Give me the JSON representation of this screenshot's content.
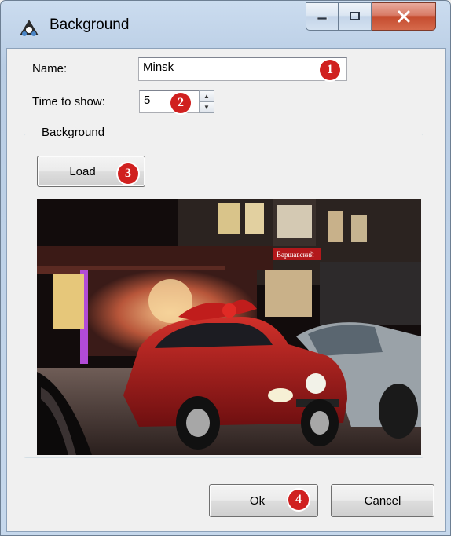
{
  "window": {
    "title": "Background"
  },
  "form": {
    "name_label": "Name:",
    "name_value": "Minsk",
    "time_label": "Time to show:",
    "time_value": "5",
    "group_label": "Background",
    "load_label": "Load"
  },
  "image": {
    "sign_text": "Варшавский"
  },
  "footer": {
    "ok_label": "Ok",
    "cancel_label": "Cancel"
  },
  "callouts": [
    "1",
    "2",
    "3",
    "4"
  ],
  "colors": {
    "callout": "#d0201f",
    "titlebar": "#c6d8ec",
    "close": "#c44b2e"
  }
}
